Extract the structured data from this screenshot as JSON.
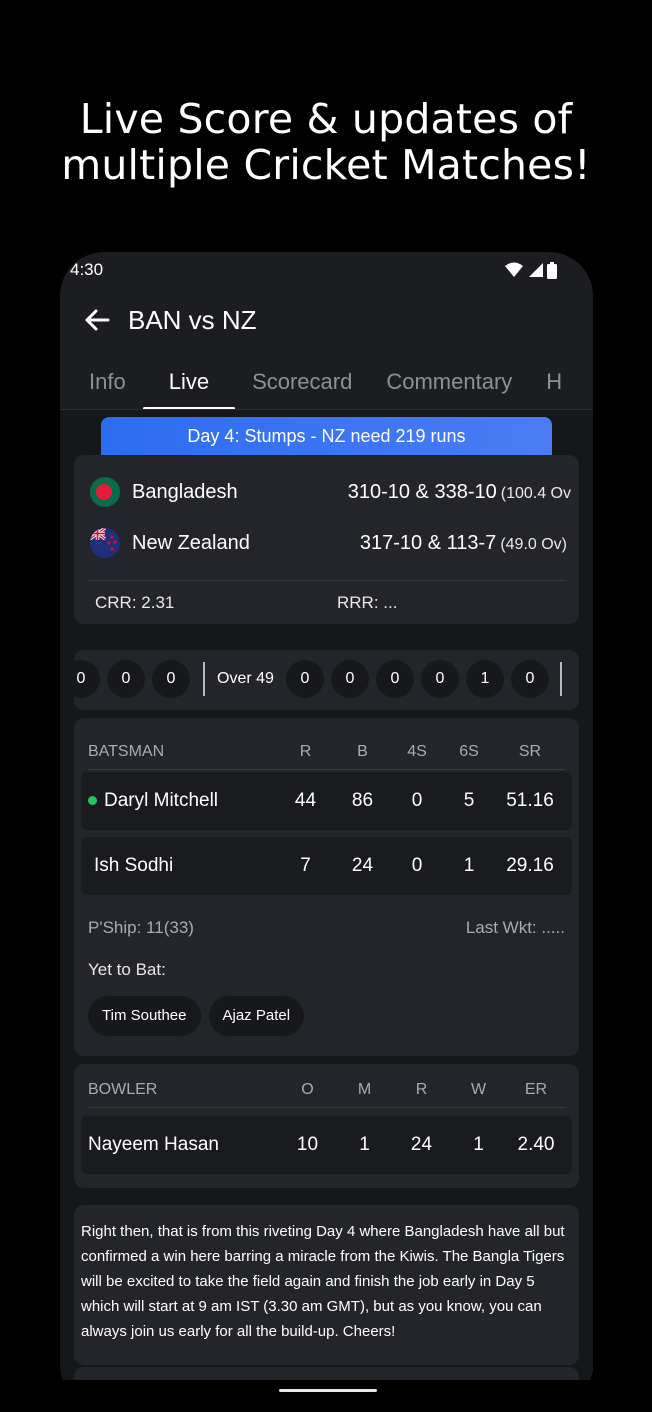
{
  "headline": {
    "line1": "Live Score & updates of",
    "line2": "multiple Cricket Matches!"
  },
  "status_bar": {
    "time": "4:30",
    "icons": [
      "wifi-icon",
      "signal-icon",
      "battery-icon"
    ]
  },
  "app_bar": {
    "title": "BAN vs NZ",
    "back_icon": "arrow-left-icon"
  },
  "tabs": [
    {
      "label": "Info",
      "active": false
    },
    {
      "label": "Live",
      "active": true
    },
    {
      "label": "Scorecard",
      "active": false
    },
    {
      "label": "Commentary",
      "active": false
    },
    {
      "label": "H",
      "active": false
    }
  ],
  "banner": "Day 4: Stumps - NZ need 219 runs",
  "score": {
    "team1": {
      "name": "Bangladesh",
      "score": "310-10 & 338-10",
      "overs": "(100.4 Ov"
    },
    "team2": {
      "name": "New Zealand",
      "score": "317-10 & 113-7",
      "overs": "(49.0 Ov)"
    },
    "crr": "CRR: 2.31",
    "rrr": "RRR: ..."
  },
  "overs": {
    "prev_balls": [
      "0",
      "0",
      "0"
    ],
    "current_label": "Over 49",
    "current_balls": [
      "0",
      "0",
      "0",
      "0",
      "1",
      "0"
    ]
  },
  "batting": {
    "headers": [
      "BATSMAN",
      "R",
      "B",
      "4S",
      "6S",
      "SR"
    ],
    "rows": [
      {
        "name": "Daryl Mitchell",
        "r": "44",
        "b": "86",
        "fours": "0",
        "sixes": "5",
        "sr": "51.16",
        "on_strike": true
      },
      {
        "name": "Ish Sodhi",
        "r": "7",
        "b": "24",
        "fours": "0",
        "sixes": "1",
        "sr": "29.16",
        "on_strike": false
      }
    ],
    "partnership": "P'Ship: 11(33)",
    "last_wicket": "Last Wkt: .....",
    "yet_to_bat_label": "Yet to Bat:",
    "yet_to_bat": [
      "Tim Southee",
      "Ajaz Patel"
    ]
  },
  "bowling": {
    "headers": [
      "BOWLER",
      "O",
      "M",
      "R",
      "W",
      "ER"
    ],
    "rows": [
      {
        "name": "Nayeem Hasan",
        "o": "10",
        "m": "1",
        "r": "24",
        "w": "1",
        "er": "2.40"
      }
    ]
  },
  "commentary": "Right then, that is from this riveting Day 4 where Bangladesh have all but confirmed a win here barring a miracle from the Kiwis. The Bangla Tigers will be excited to take the field again and finish the job early in Day 5 which will start at 9 am IST (3.30 am GMT), but as you know, you can always join us early for all the build-up. Cheers!",
  "colors": {
    "accent_blue": "#2c6df0",
    "live_dot": "#22c55e",
    "bangladesh_green": "#0a6b4a",
    "bangladesh_red": "#e21b3c"
  }
}
